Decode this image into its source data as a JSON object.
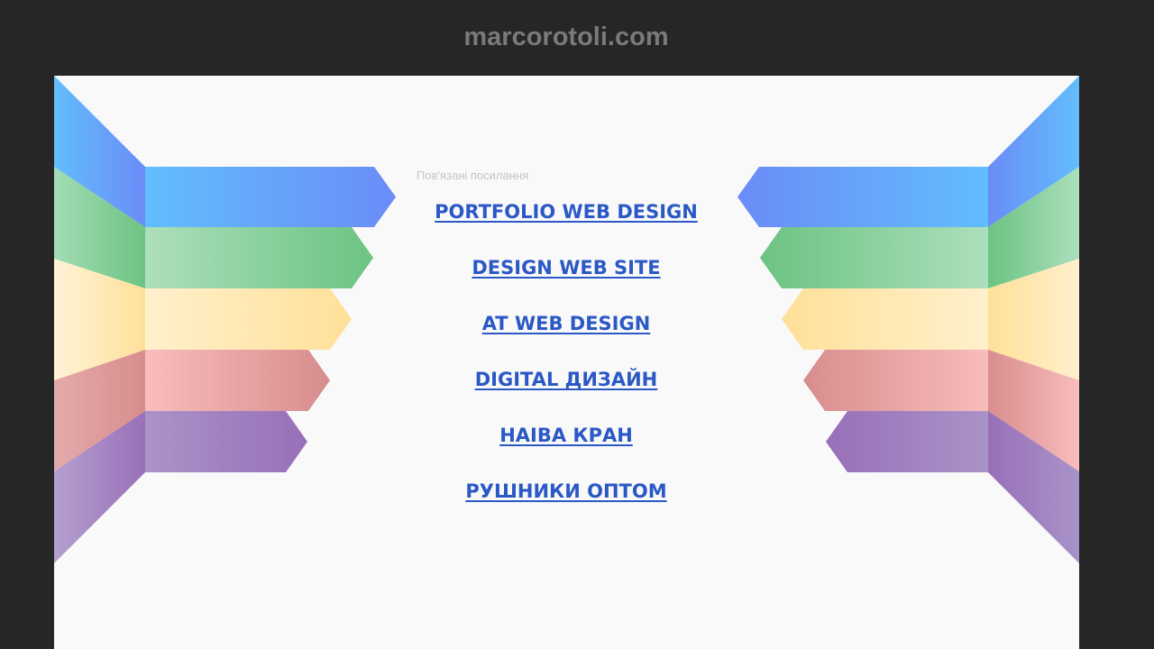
{
  "header": {
    "domain": "marcorotoli.com"
  },
  "colors": {
    "background": "#262626",
    "panel": "#f9f9fa",
    "link": "#2a58c5",
    "blue": [
      "#6a8cf8",
      "#62bdfd"
    ],
    "green": [
      "#acdfbc",
      "#6cc383"
    ],
    "yellow": [
      "#fff0cc",
      "#ffe099"
    ],
    "red": [
      "#d88d8d",
      "#f9bcbc"
    ],
    "purple": [
      "#a993c8",
      "#9870b8"
    ]
  },
  "main": {
    "related_label": "Пов'язані посилання",
    "links": [
      {
        "label": "PORTFOLIO WEB DESIGN"
      },
      {
        "label": "DESIGN WEB SITE"
      },
      {
        "label": "AT WEB DESIGN"
      },
      {
        "label": "DIGITAL ДИЗАЙН"
      },
      {
        "label": "НАІВА КРАН"
      },
      {
        "label": "РУШНИКИ ОПТОМ"
      }
    ]
  }
}
